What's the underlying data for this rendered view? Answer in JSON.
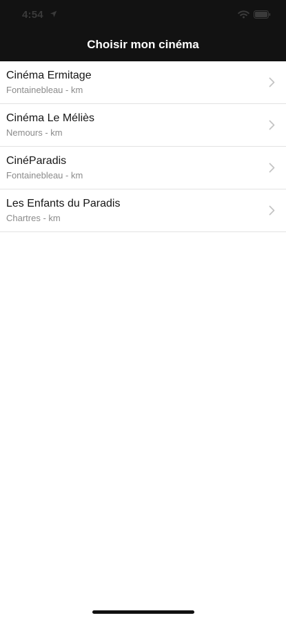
{
  "status_bar": {
    "time": "4:54",
    "icons": [
      "location-arrow-icon",
      "wifi-icon",
      "battery-icon"
    ]
  },
  "nav": {
    "title": "Choisir mon cinéma"
  },
  "cinemas": [
    {
      "name": "Cinéma Ermitage",
      "subtitle": "Fontainebleau - km"
    },
    {
      "name": "Cinéma Le Méliès",
      "subtitle": "Nemours - km"
    },
    {
      "name": "CinéParadis",
      "subtitle": "Fontainebleau - km"
    },
    {
      "name": "Les Enfants du Paradis",
      "subtitle": "Chartres - km"
    }
  ],
  "colors": {
    "header_background": "#121212",
    "title_text": "#ffffff",
    "row_title": "#151515",
    "row_subtitle": "#8a8a8a",
    "separator": "#e2e2e2",
    "chevron": "#c4c4c4",
    "home_indicator": "#111111"
  }
}
